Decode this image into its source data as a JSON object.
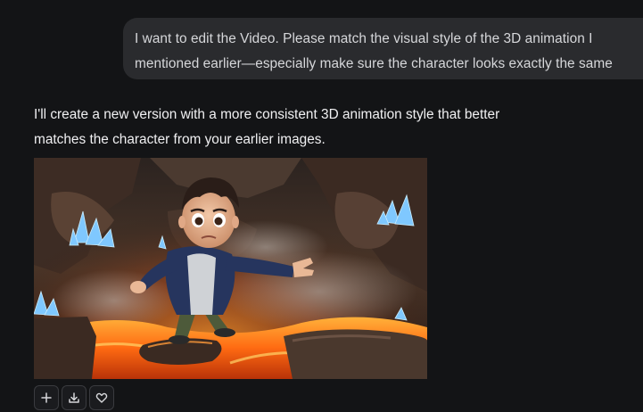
{
  "conversation": {
    "user_message": {
      "line1": "I want to edit the Video. Please match the visual style of the 3D animation I",
      "line2": "mentioned earlier—especially make sure the character looks exactly the same"
    },
    "assistant_message": {
      "line1": "I'll create a new version with a more consistent 3D animation style that better",
      "line2": "matches the character from your earlier images."
    },
    "media": {
      "kind": "generated-image",
      "subject": "3D animated character balancing on a rock over lava in a cave with blue crystals"
    },
    "actions": [
      {
        "name": "add",
        "icon": "plus-icon"
      },
      {
        "name": "download",
        "icon": "download-icon"
      },
      {
        "name": "like",
        "icon": "heart-icon"
      }
    ]
  },
  "colors": {
    "background": "#131416",
    "bubble": "#2a2b2e",
    "text": "#f0f0f2",
    "lava": "#ff7a1a",
    "crystal": "#7fc8ff"
  }
}
